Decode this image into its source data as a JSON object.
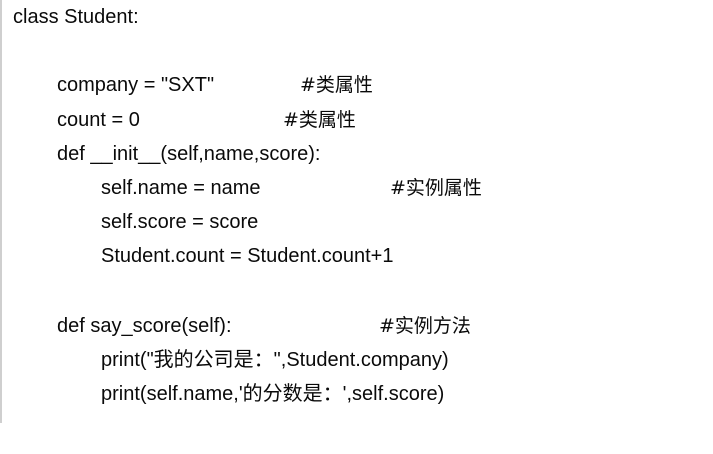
{
  "code": {
    "line_class_header": "class Student:",
    "line_company": {
      "code": "company = \"SXT\"",
      "comment": "#类属性"
    },
    "line_count": {
      "code": "count = 0",
      "comment": "#类属性"
    },
    "line_init_def": "def __init__(self,name,score):",
    "line_self_name": {
      "code": "self.name = name",
      "comment": "#实例属性"
    },
    "line_self_score": "self.score = score",
    "line_count_increment": "Student.count = Student.count+1",
    "line_say_score_def": {
      "code": "def say_score(self):",
      "comment": "#实例方法"
    },
    "line_print_company": "print(\"我的公司是：\",Student.company)",
    "line_print_score": "print(self.name,'的分数是：',self.score)"
  }
}
